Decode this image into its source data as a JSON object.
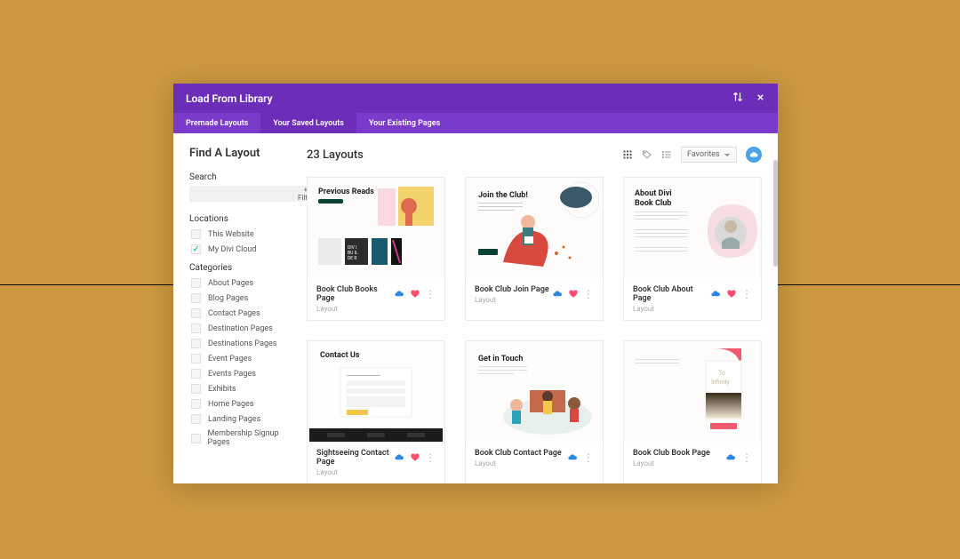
{
  "header": {
    "title": "Load From Library"
  },
  "tabs": [
    {
      "label": "Premade Layouts",
      "active": false
    },
    {
      "label": "Your Saved Layouts",
      "active": true
    },
    {
      "label": "Your Existing Pages",
      "active": false
    }
  ],
  "sidebar": {
    "title": "Find A Layout",
    "search_label": "Search",
    "search_value": "",
    "filter_label": "+ Filter",
    "locations_title": "Locations",
    "locations": [
      {
        "label": "This Website",
        "checked": false
      },
      {
        "label": "My Divi Cloud",
        "checked": true
      }
    ],
    "categories_title": "Categories",
    "categories": [
      {
        "label": "About Pages"
      },
      {
        "label": "Blog Pages"
      },
      {
        "label": "Contact Pages"
      },
      {
        "label": "Destination Pages"
      },
      {
        "label": "Destinations Pages"
      },
      {
        "label": "Event Pages"
      },
      {
        "label": "Events Pages"
      },
      {
        "label": "Exhibits"
      },
      {
        "label": "Home Pages"
      },
      {
        "label": "Landing Pages"
      },
      {
        "label": "Membership Signup Pages"
      }
    ]
  },
  "main": {
    "count_title": "23 Layouts",
    "sort_value": "Favorites"
  },
  "layouts": [
    {
      "title": "Book Club Books Page",
      "sub": "Layout",
      "cloud": true,
      "heart": true
    },
    {
      "title": "Book Club Join Page",
      "sub": "Layout",
      "cloud": true,
      "heart": true
    },
    {
      "title": "Book Club About Page",
      "sub": "Layout",
      "cloud": true,
      "heart": true
    },
    {
      "title": "Sightseeing Contact Page",
      "sub": "Layout",
      "cloud": true,
      "heart": true
    },
    {
      "title": "Book Club Contact Page",
      "sub": "Layout",
      "cloud": true,
      "heart": false
    },
    {
      "title": "Book Club Book Page",
      "sub": "Layout",
      "cloud": true,
      "heart": false
    }
  ],
  "thumbs": {
    "t0_title": "Previous Reads",
    "t1_title": "Join the Club!",
    "t2_title1": "About Divi",
    "t2_title2": "Book Club",
    "t3_title": "Contact Us",
    "t4_title": "Get in Touch",
    "t5_word1": "To",
    "t5_word2": "Infinity"
  }
}
